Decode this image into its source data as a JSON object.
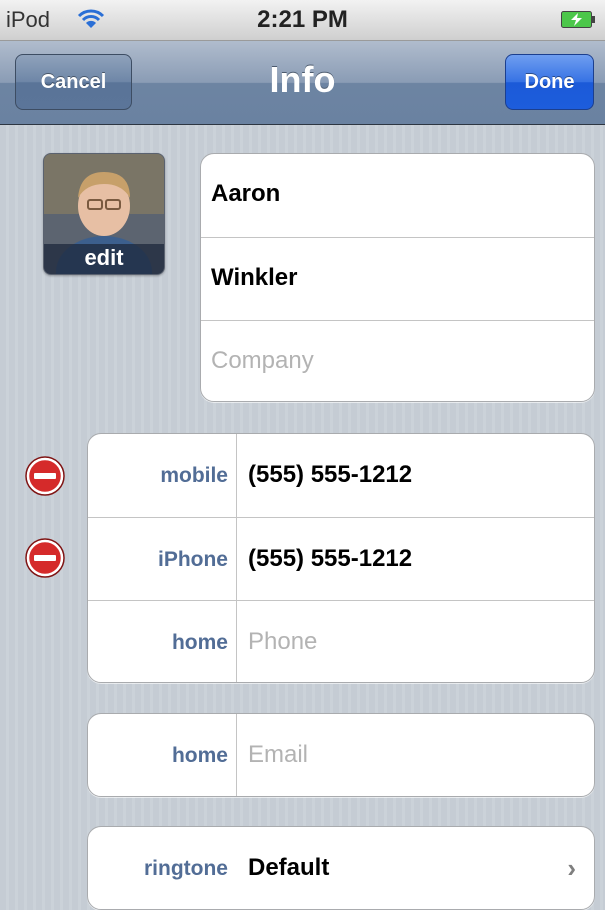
{
  "status": {
    "carrier": "iPod",
    "time": "2:21 PM"
  },
  "nav": {
    "cancel_label": "Cancel",
    "title": "Info",
    "done_label": "Done"
  },
  "photo": {
    "edit_label": "edit"
  },
  "name": {
    "first": "Aaron",
    "last": "Winkler",
    "company_placeholder": "Company"
  },
  "phones": [
    {
      "label": "mobile",
      "value": "(555) 555-1212"
    },
    {
      "label": "iPhone",
      "value": "(555) 555-1212"
    },
    {
      "label": "home",
      "placeholder": "Phone"
    }
  ],
  "email": {
    "label": "home",
    "placeholder": "Email"
  },
  "ringtone": {
    "label": "ringtone",
    "value": "Default"
  },
  "colors": {
    "label_blue": "#526d96",
    "done_blue": "#1b5ad8",
    "delete_red": "#d52a2a"
  }
}
